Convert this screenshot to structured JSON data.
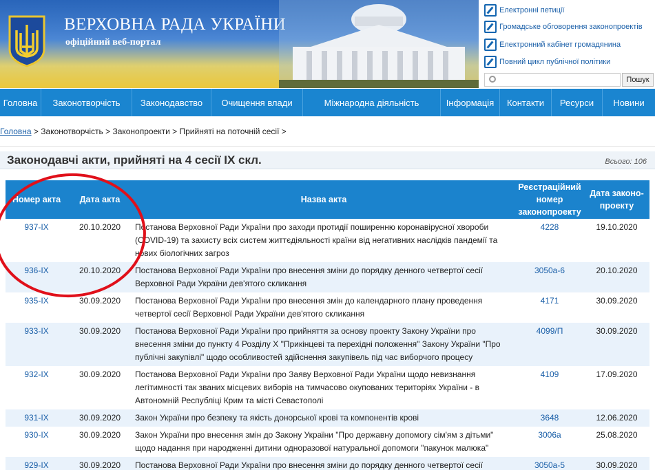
{
  "header": {
    "site_title": "ВЕРХОВНА РАДА УКРАЇНИ",
    "site_subtitle": "офіційний веб-портал",
    "links": [
      {
        "label": "Електронні петиції",
        "icon": "edit-icon"
      },
      {
        "label": "Громадське обговорення законопроектів",
        "icon": "edit-icon"
      },
      {
        "label": "Електронний кабінет громадянина",
        "icon": "edit-icon"
      },
      {
        "label": "Повний цикл публічної політики",
        "icon": "edit-icon"
      }
    ],
    "search": {
      "placeholder": "",
      "button": "Пошук"
    }
  },
  "nav": {
    "items": [
      "Головна",
      "Законотворчість",
      "Законодавство",
      "Очищення влади",
      "Міжнародна діяльність",
      "Інформація",
      "Контакти",
      "Ресурси",
      "Новини"
    ]
  },
  "breadcrumb": {
    "home": "Головна",
    "rest": " > Законотворчість > Законопроекти > Прийняті на поточній сесії >"
  },
  "page": {
    "title": "Законодавчі акти, прийняті на 4 сесії IX скл.",
    "total": "Всього: 106"
  },
  "table": {
    "headers": {
      "num": "Номер акта",
      "date": "Дата акта",
      "name": "Назва акта",
      "reg": "Реєстраційний номер законопроекту",
      "pdate": "Дата законо-проекту"
    },
    "rows": [
      {
        "num": "937-IX",
        "date": "20.10.2020",
        "name": "Постанова Верховної Ради України про заходи протидії поширенню коронавірусної хвороби (COVID-19) та захисту всіх систем життєдіяльності країни від негативних наслідків пандемії та нових біологічних загроз",
        "reg": "4228",
        "pdate": "19.10.2020"
      },
      {
        "num": "936-IX",
        "date": "20.10.2020",
        "name": "Постанова Верховної Ради України про внесення зміни до порядку денного четвертої сесії Верховної Ради України дев'ятого скликання",
        "reg": "3050а-6",
        "pdate": "20.10.2020"
      },
      {
        "num": "935-IX",
        "date": "30.09.2020",
        "name": "Постанова Верховної Ради України про внесення змін до календарного плану проведення четвертої сесії Верховної Ради України дев'ятого скликання",
        "reg": "4171",
        "pdate": "30.09.2020"
      },
      {
        "num": "933-IX",
        "date": "30.09.2020",
        "name": "Постанова Верховної Ради України про прийняття за основу проекту Закону України про внесення зміни до пункту 4 Розділу X \"Прикінцеві та перехідні положення\" Закону України \"Про публічні закупівлі\" щодо особливостей здійснення закупівель під час виборчого процесу",
        "reg": "4099/П",
        "pdate": "30.09.2020"
      },
      {
        "num": "932-IX",
        "date": "30.09.2020",
        "name": "Постанова Верховної Ради України про Заяву Верховної Ради України щодо невизнання легітимності так званих місцевих виборів на тимчасово окупованих територіях України - в Автономній Республіці Крим та місті Севастополі",
        "reg": "4109",
        "pdate": "17.09.2020"
      },
      {
        "num": "931-IX",
        "date": "30.09.2020",
        "name": "Закон України про безпеку та якість донорської крові та компонентів крові",
        "reg": "3648",
        "pdate": "12.06.2020"
      },
      {
        "num": "930-IX",
        "date": "30.09.2020",
        "name": "Закон України про внесення змін до Закону України \"Про державну допомогу сім'ям з дітьми\" щодо надання при народженні дитини одноразової натуральної допомоги \"пакунок малюка\"",
        "reg": "3006а",
        "pdate": "25.08.2020"
      },
      {
        "num": "929-IX",
        "date": "30.09.2020",
        "name": "Постанова Верховної Ради України про внесення зміни до порядку денного четвертої сесії Верховної Ради України дев'ятого скликання",
        "reg": "3050а-5",
        "pdate": "30.09.2020"
      }
    ]
  },
  "colors": {
    "nav": "#1a85d0",
    "table_header": "#1b83cd",
    "link": "#1a5fa8",
    "annotation": "#e0101a"
  }
}
